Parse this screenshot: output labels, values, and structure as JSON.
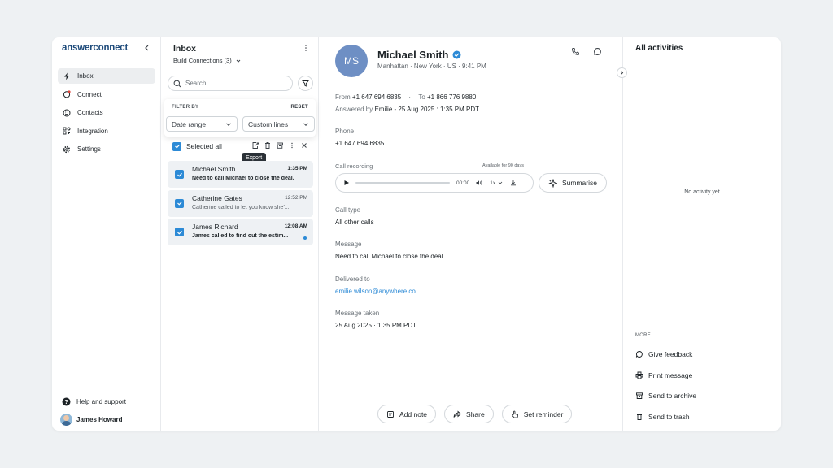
{
  "sidebar": {
    "logo": "answerconnect",
    "items": [
      {
        "label": "Inbox",
        "icon": "bolt-icon",
        "active": true
      },
      {
        "label": "Connect",
        "icon": "connect-icon"
      },
      {
        "label": "Contacts",
        "icon": "smiley-icon"
      },
      {
        "label": "Integration",
        "icon": "integration-icon"
      },
      {
        "label": "Settings",
        "icon": "gear-icon"
      }
    ],
    "help": "Help and support",
    "user": "James Howard"
  },
  "inbox": {
    "title": "Inbox",
    "subtitle": "Build Connections (3)",
    "search_placeholder": "Search",
    "filter_by": "FILTER BY",
    "reset": "RESET",
    "date_range": "Date range",
    "custom_lines": "Custom lines",
    "selected_all": "Selected all",
    "tooltip": "Export",
    "messages": [
      {
        "name": "Michael Smith",
        "time": "1:35 PM",
        "preview": "Need to call Michael to close the deal.",
        "bold": true,
        "unread": false
      },
      {
        "name": "Catherine Gates",
        "time": "12:52 PM",
        "preview": "Catherine called to let you know she'...",
        "bold": false,
        "unread": false
      },
      {
        "name": "James Richard",
        "time": "12:08 AM",
        "preview": "James called to find out the estim...",
        "bold": true,
        "unread": true
      }
    ]
  },
  "detail": {
    "initials": "MS",
    "name": "Michael Smith",
    "location": "Manhattan · New York · US · 9:41 PM",
    "from_label": "From",
    "from": "+1 647 694 6835",
    "to_label": "To",
    "to": "+1 866 776 9880",
    "answered_label": "Answered by",
    "answered": "Emilie - 25 Aug 2025 : 1:35 PM PDT",
    "phone_label": "Phone",
    "phone": "+1 647 694 6835",
    "recording_label": "Call recording",
    "available": "Available for 90 days",
    "duration": "00:00",
    "speed": "1x",
    "summarise": "Summarise",
    "call_type_label": "Call type",
    "call_type": "All other calls",
    "message_label": "Message",
    "message": "Need to call Michael to close the deal.",
    "delivered_label": "Delivered to",
    "delivered": "emilie.wilson@anywhere.co",
    "taken_label": "Message taken",
    "taken": "25 Aug 2025 · 1:35 PM PDT",
    "buttons": {
      "note": "Add note",
      "share": "Share",
      "reminder": "Set reminder"
    }
  },
  "activities": {
    "title": "All activities",
    "empty": "No activity yet",
    "more": "MORE",
    "items": [
      "Give feedback",
      "Print message",
      "Send to archive",
      "Send to trash"
    ]
  },
  "colors": {
    "accent": "#2c8ad6",
    "avatar": "#6e8fc4"
  }
}
